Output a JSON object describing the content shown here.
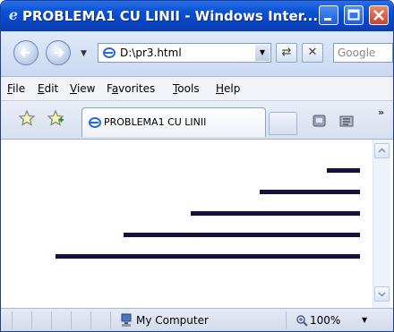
{
  "window": {
    "title": "PROBLEMA1 CU LINII - Windows Inter..."
  },
  "navigation": {
    "address": "D:\\pr3.html",
    "search_placeholder": "Google"
  },
  "menu": {
    "items": [
      {
        "accel": "F",
        "rest": "ile"
      },
      {
        "accel": "E",
        "rest": "dit"
      },
      {
        "accel": "V",
        "rest": "iew"
      },
      {
        "pre": "F",
        "accel": "a",
        "rest": "vorites"
      },
      {
        "accel": "T",
        "rest": "ools"
      },
      {
        "accel": "H",
        "rest": "elp"
      }
    ]
  },
  "tab": {
    "label": "PROBLEMA1 CU LINII"
  },
  "status": {
    "zone": "My Computer",
    "zoom": "100%"
  },
  "page_content": {
    "line_color": "#14123a",
    "lines_count": 5
  },
  "colors": {
    "titlebar": "#0a52d4",
    "chrome": "#dfe9f8"
  }
}
